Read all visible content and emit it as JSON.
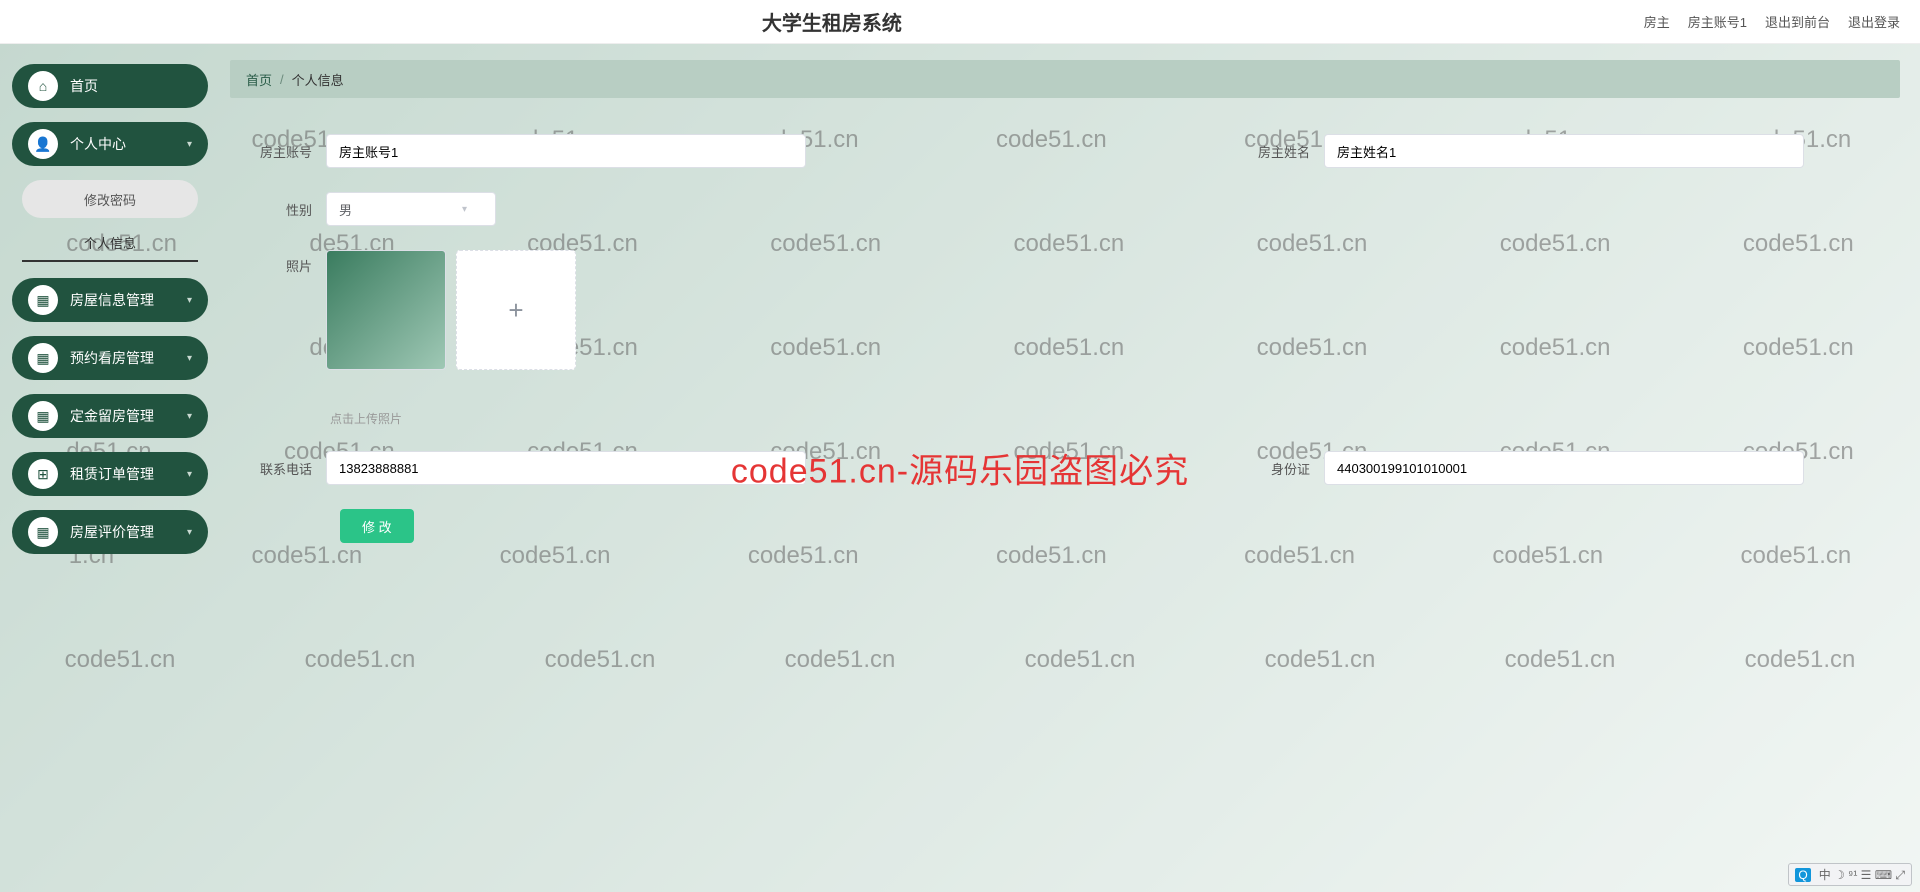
{
  "header": {
    "title": "大学生租房系统",
    "userRole": "房主",
    "userAccount": "房主账号1",
    "exitFront": "退出到前台",
    "logout": "退出登录"
  },
  "sidebar": {
    "home": "首页",
    "personal": {
      "label": "个人中心",
      "children": {
        "changePwd": "修改密码",
        "profile": "个人信息"
      }
    },
    "menus": [
      "房屋信息管理",
      "预约看房管理",
      "定金留房管理",
      "租赁订单管理",
      "房屋评价管理"
    ]
  },
  "breadcrumb": {
    "home": "首页",
    "current": "个人信息"
  },
  "form": {
    "accountLabel": "房主账号",
    "accountValue": "房主账号1",
    "nameLabel": "房主姓名",
    "nameValue": "房主姓名1",
    "genderLabel": "性别",
    "genderValue": "男",
    "photoLabel": "照片",
    "uploadHint": "点击上传照片",
    "phoneLabel": "联系电话",
    "phoneValue": "13823888881",
    "idLabel": "身份证",
    "idValue": "440300199101010001",
    "submit": "修 改"
  },
  "watermark": {
    "text": "code51.cn",
    "bigText": "code51.cn-源码乐园盗图必究"
  },
  "ime": {
    "icon": "Q",
    "rest": "中 ☽ ⁹¹ ☰ ⌨ ⤢"
  }
}
